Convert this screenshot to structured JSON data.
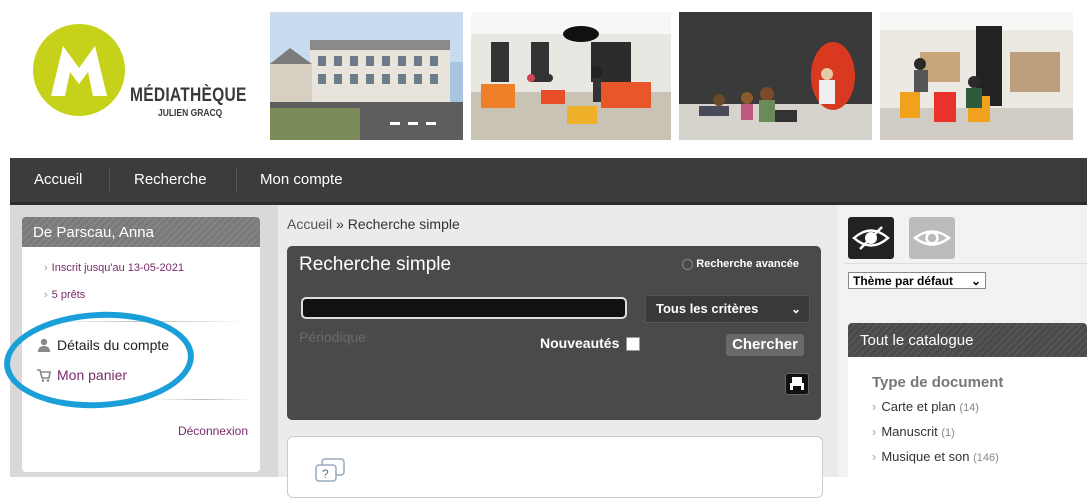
{
  "logo": {
    "title": "MÉDIATHÈQUE",
    "subtitle": "JULIEN GRACQ",
    "color": "#c6d21a"
  },
  "nav": {
    "items": [
      "Accueil",
      "Recherche",
      "Mon compte"
    ]
  },
  "user_panel": {
    "name": "De Parscau, Anna",
    "registered": "Inscrit jusqu'au 13-05-2021",
    "loans": "5 prêts",
    "account_details": "Détails du compte",
    "cart": "Mon panier",
    "logout": "Déconnexion"
  },
  "breadcrumb": {
    "home": "Accueil",
    "separator": "»",
    "current": "Recherche simple"
  },
  "search": {
    "title": "Recherche simple",
    "advanced": "Recherche avancée",
    "input_value": "",
    "criteria": "Tous les critères",
    "periodical_placeholder": "Périodique",
    "new_items_label": "Nouveautés",
    "search_button": "Chercher"
  },
  "accessibility": {
    "theme": "Thème par défaut"
  },
  "catalog": {
    "title": "Tout le catalogue",
    "facet_title": "Type de document",
    "facets": [
      {
        "label": "Carte et plan",
        "count": "(14)"
      },
      {
        "label": "Manuscrit",
        "count": "(1)"
      },
      {
        "label": "Musique et son",
        "count": "(146)"
      }
    ]
  },
  "colors": {
    "accent_purple": "#7a2a6a",
    "highlight_blue": "#1b9fd9",
    "nav_bg": "#3c3c3c"
  }
}
